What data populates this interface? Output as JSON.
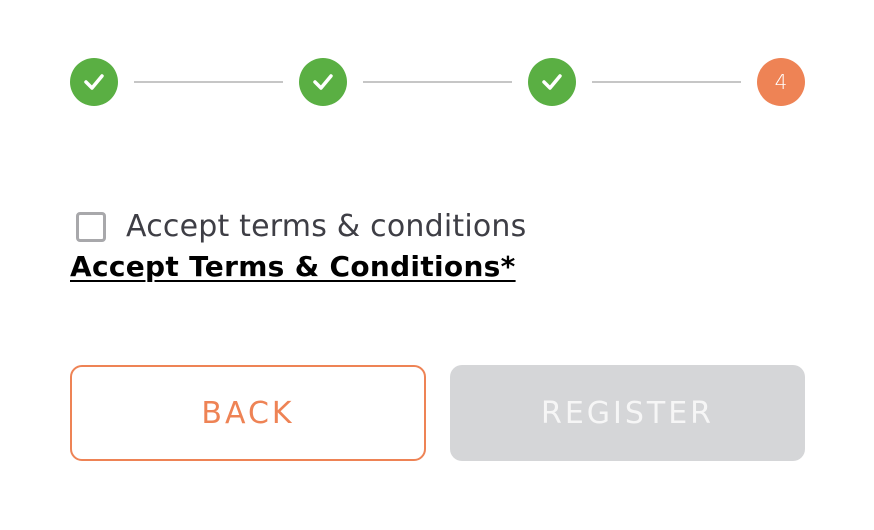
{
  "stepper": {
    "steps": [
      {
        "status": "complete",
        "icon": "check-icon"
      },
      {
        "status": "complete",
        "icon": "check-icon"
      },
      {
        "status": "complete",
        "icon": "check-icon"
      },
      {
        "status": "current",
        "label": "4"
      }
    ],
    "complete_color": "#5aaf43",
    "current_color": "#ee8355",
    "connector_color": "#c6c6c6"
  },
  "terms": {
    "checkbox_checked": false,
    "checkbox_label": "Accept terms & conditions",
    "link_text": "Accept Terms & Conditions*"
  },
  "actions": {
    "back_label": "BACK",
    "register_label": "REGISTER",
    "register_disabled": true,
    "accent_color": "#ee8355"
  }
}
